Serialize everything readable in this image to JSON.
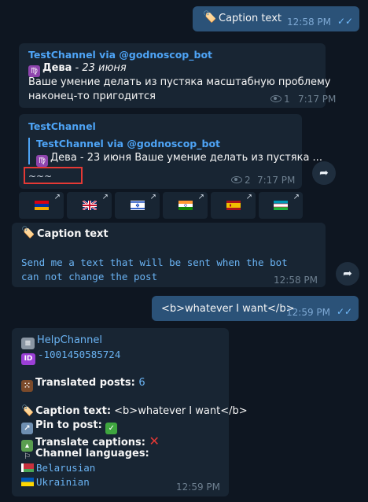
{
  "msg1": {
    "icon": "🏷️",
    "text": "Caption text",
    "time": "12:58 PM",
    "ticks": "✓✓"
  },
  "msg2": {
    "author": "TestChannel via @godnoscop_bot",
    "sign_icon": "♍",
    "sign_title": "Дева",
    "sign_date": " - 23 июня",
    "line1": "Ваше умение делать из пустяка масштабную проблему",
    "line2": "наконец-то пригодится",
    "views": "1",
    "time": "7:17 PM"
  },
  "msg3": {
    "author": "TestChannel",
    "quote_author": "TestChannel via @godnoscop_bot",
    "quote_text": "Дева - 23 июня Ваше умение делать из пустяка ...",
    "tilde": "~~~",
    "views": "2",
    "time": "7:17 PM",
    "buttons": [
      "armenia-flag",
      "uk-flag",
      "israel-flag",
      "india-flag",
      "spain-flag",
      "uzbekistan-flag"
    ],
    "corner_icon": "↗"
  },
  "msg4": {
    "icon": "🏷️",
    "caption": "Caption text",
    "line1": "Send me a text that will be sent when the bot",
    "line2": "can not change the post",
    "time": "12:58 PM"
  },
  "msg5": {
    "text": "<b>whatever I want</b>",
    "time": "12:59 PM",
    "ticks": "✓✓"
  },
  "msg6": {
    "channel": "HelpChannel",
    "id_badge": "ID",
    "id_value": "-1001450585724",
    "translated_label": "Translated posts: ",
    "translated_value": "6",
    "caption_label": "Caption text:",
    "caption_value": " <b>whatever I want</b>",
    "pin_label": "Pin to post: ",
    "translate_label": "Translate captions: ",
    "langs_label": "Channel languages:",
    "lang1": "Belarusian",
    "lang2": "Ukrainian",
    "time": "12:59 PM"
  },
  "colors": {
    "bg": "#0e1621",
    "incoming": "#182533",
    "outgoing": "#2b5278",
    "link": "#4ea4f6",
    "highlight_box": "#e53935"
  }
}
